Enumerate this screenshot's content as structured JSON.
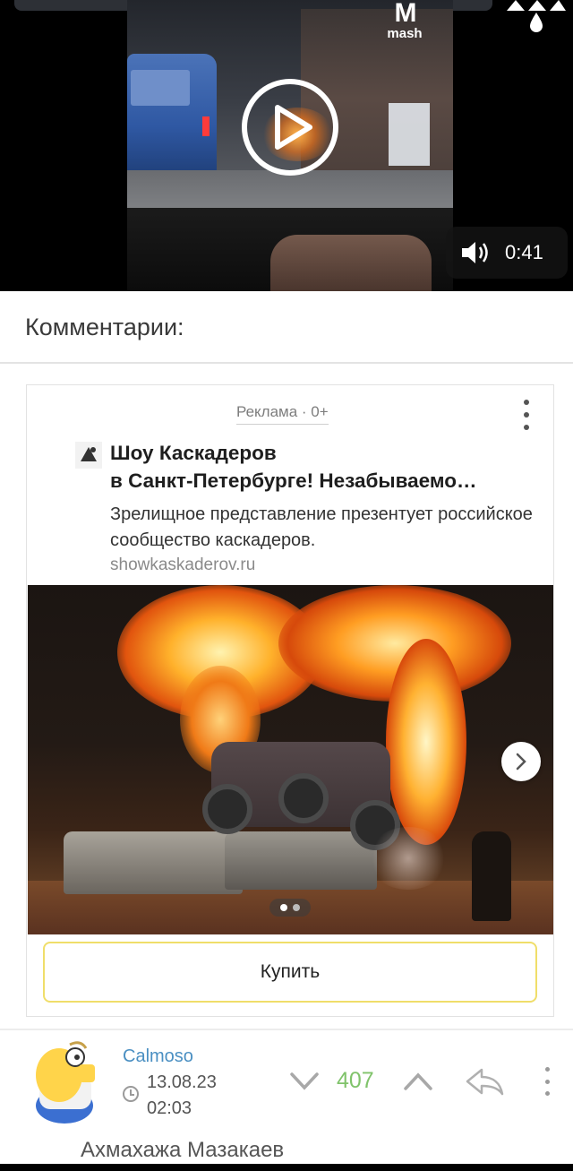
{
  "video": {
    "watermark_symbol": "M",
    "watermark_text": "mash",
    "duration": "0:41",
    "play_icon": "play-icon",
    "volume_icon": "volume-icon"
  },
  "comments_section": {
    "title": "Комментарии:"
  },
  "ad": {
    "label": "Реклама · 0+",
    "title_line1": "Шоу Каскадеров",
    "title_line2": "в Санкт-Петербурге! Незабываемо…",
    "description": "Зрелищное представление презентует российское сообщество каскадеров.",
    "domain": "showkaskaderov.ru",
    "buy_label": "Купить",
    "carousel_slides": 2,
    "carousel_active": 1
  },
  "comment": {
    "username": "Calmoso",
    "date": "13.08.23",
    "time": "02:03",
    "rating": "407",
    "text_preview": "Ахмахажа Мазакаев"
  },
  "colors": {
    "username": "#4a8fc2",
    "rating": "#80c36b",
    "buy_border": "#f0de6a"
  }
}
